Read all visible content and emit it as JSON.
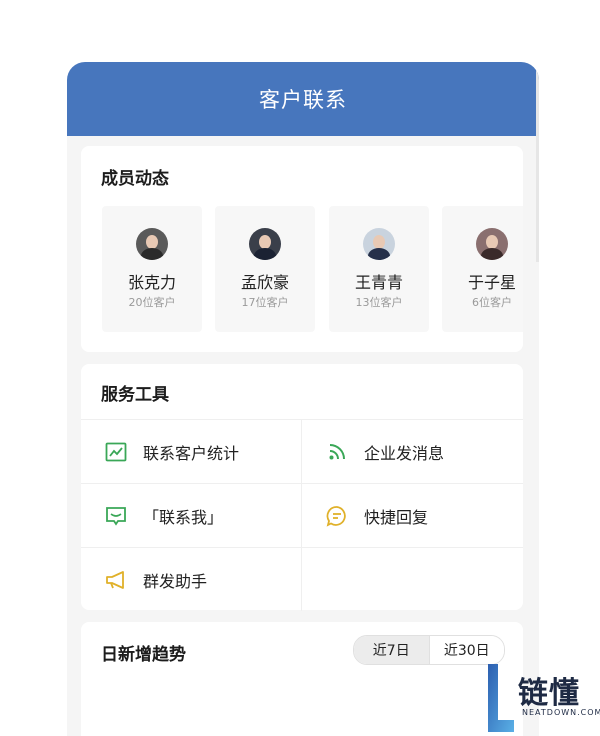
{
  "header": {
    "title": "客户联系"
  },
  "members": {
    "title": "成员动态",
    "items": [
      {
        "name": "张克力",
        "count": "20位客户"
      },
      {
        "name": "孟欣豪",
        "count": "17位客户"
      },
      {
        "name": "王青青",
        "count": "13位客户"
      },
      {
        "name": "于子星",
        "count": "6位客户"
      }
    ]
  },
  "tools": {
    "title": "服务工具",
    "items": [
      {
        "label": "联系客户统计",
        "icon": "chart-icon",
        "color": "#3aa757"
      },
      {
        "label": "企业发消息",
        "icon": "rss-icon",
        "color": "#3aa757"
      },
      {
        "label": "「联系我」",
        "icon": "message-icon",
        "color": "#3aa757"
      },
      {
        "label": "快捷回复",
        "icon": "chat-bubble-icon",
        "color": "#e0b12a"
      },
      {
        "label": "群发助手",
        "icon": "megaphone-icon",
        "color": "#e0b12a"
      }
    ]
  },
  "trend": {
    "title": "日新增趋势",
    "range_options": [
      "近7日",
      "近30日"
    ],
    "selected": "近7日"
  },
  "watermark": {
    "brand": "链懂",
    "sub": "NEATDOWN.COM"
  },
  "colors": {
    "header": "#4776bd",
    "green": "#3aa757",
    "yellow": "#e0b12a"
  }
}
